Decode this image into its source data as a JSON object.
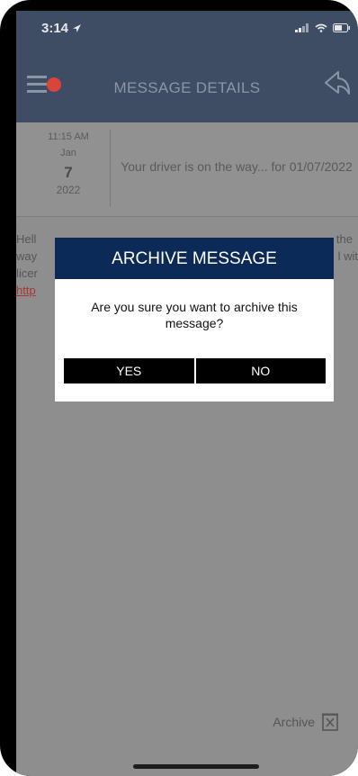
{
  "status_bar": {
    "time": "3:14"
  },
  "header": {
    "title": "MESSAGE DETAILS"
  },
  "message": {
    "time": "11:15 AM",
    "month": "Jan",
    "day": "7",
    "year": "2022",
    "subject": "Your driver is on the way... for 01/07/2022",
    "body_line1": "Hell",
    "body_line1_right": "the",
    "body_line2": "way",
    "body_line2_right": "l wit",
    "body_line3": "licer",
    "body_link": "http"
  },
  "modal": {
    "title": "ARCHIVE MESSAGE",
    "message": "Are you sure you want to archive this message?",
    "yes_label": "YES",
    "no_label": "NO"
  },
  "footer": {
    "archive_label": "Archive"
  },
  "colors": {
    "header_bg": "#3e4d63",
    "modal_title_bg": "#0b2a57",
    "notification_dot": "#d9453b"
  }
}
